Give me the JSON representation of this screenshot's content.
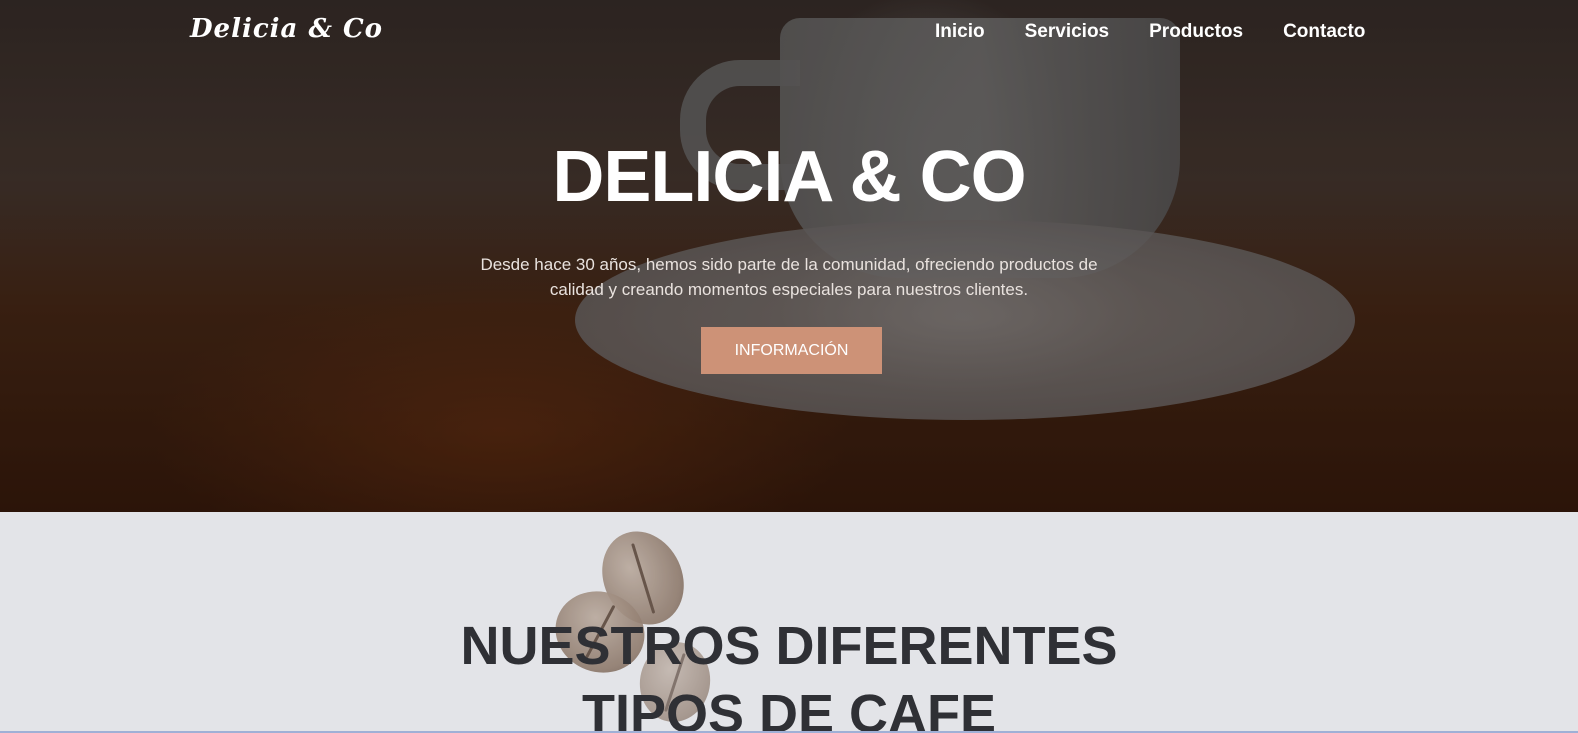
{
  "nav": {
    "logo": "Delicia & Co",
    "links": [
      "Inicio",
      "Servicios",
      "Productos",
      "Contacto"
    ]
  },
  "hero": {
    "title": "DELICIA & CO",
    "text": "Desde hace 30 años, hemos sido parte de la comunidad, ofreciendo productos de calidad y creando momentos especiales para nuestros clientes.",
    "button_label": "INFORMACIÓN"
  },
  "section": {
    "title_line1": "NUESTROS DIFERENTES",
    "title_line2": "TIPOS DE CAFE"
  },
  "colors": {
    "accent": "#cd9277",
    "section_bg": "#e3e4e8",
    "title_dark": "#2f3035"
  }
}
